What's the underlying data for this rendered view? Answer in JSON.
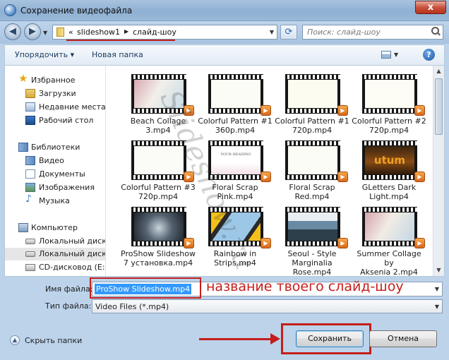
{
  "window": {
    "title": "Сохранение видеофайла",
    "close_glyph": "x"
  },
  "nav": {
    "back_icon": "back-arrow-icon",
    "forward_icon": "forward-arrow-icon",
    "breadcrumbs": [
      "slideshow1",
      "слайд-шоу"
    ],
    "breadcrumb_prefix": "«",
    "search_placeholder": "Поиск: слайд-шоу"
  },
  "toolbar": {
    "organize": "Упорядочить ▾",
    "new_folder": "Новая папка"
  },
  "sidebar": {
    "items": [
      {
        "label": "Избранное",
        "icon": "star-icon"
      },
      {
        "label": "Загрузки",
        "icon": "downloads-folder-icon"
      },
      {
        "label": "Недавние места",
        "icon": "recent-places-icon"
      },
      {
        "label": "Рабочий стол",
        "icon": "desktop-icon"
      },
      {
        "label": "Библиотеки",
        "icon": "libraries-icon"
      },
      {
        "label": "Видео",
        "icon": "video-library-icon"
      },
      {
        "label": "Документы",
        "icon": "documents-icon"
      },
      {
        "label": "Изображения",
        "icon": "pictures-icon"
      },
      {
        "label": "Музыка",
        "icon": "music-icon"
      },
      {
        "label": "Компьютер",
        "icon": "computer-icon"
      },
      {
        "label": "Локальный диск (",
        "icon": "drive-icon"
      },
      {
        "label": "Локальный диск (",
        "icon": "drive-icon"
      },
      {
        "label": "CD-дисковод (E:)",
        "icon": "cd-drive-icon"
      }
    ]
  },
  "files": [
    {
      "line1": "Beach Collage",
      "line2": "3.mp4",
      "line3": ""
    },
    {
      "line1": "Colorful Pattern #1",
      "line2": "360p.mp4",
      "line3": ""
    },
    {
      "line1": "Colorful Pattern #1",
      "line2": "720p.mp4",
      "line3": ""
    },
    {
      "line1": "Colorful Pattern #2",
      "line2": "720p.mp4",
      "line3": ""
    },
    {
      "line1": "Colorful Pattern #3",
      "line2": "720p.mp4",
      "line3": ""
    },
    {
      "line1": "Floral Scrap",
      "line2": "Pink.mp4",
      "line3": ""
    },
    {
      "line1": "Floral Scrap",
      "line2": "Red.mp4",
      "line3": ""
    },
    {
      "line1": "GLetters Dark",
      "line2": "Light.mp4",
      "line3": ""
    },
    {
      "line1": "ProShow Slideshow",
      "line2": "7 установка.mp4",
      "line3": ""
    },
    {
      "line1": "Rainbow in",
      "line2": "Strips.mp4",
      "line3": ""
    },
    {
      "line1": "Seoul - Style",
      "line2": "Marginalia",
      "line3": "Rose.mp4"
    },
    {
      "line1": "Summer Collage by",
      "line2": "Aksenia 2.mp4",
      "line3": ""
    }
  ],
  "thumb_text": {
    "floral_pink_heading": "YOUR HEADING",
    "gletters_word": "utum"
  },
  "form": {
    "filename_label": "Имя файла:",
    "filename_value": "ProShow Slideshow.mp4",
    "filetype_label": "Тип файла:",
    "filetype_value": "Video Files (*.mp4)"
  },
  "annotation": "название твоего слайд-шоу",
  "watermark": "Slideshow.ru",
  "footer": {
    "hide_folders": "Скрыть папки",
    "save": "Сохранить",
    "cancel": "Отмена"
  },
  "colors": {
    "accent_red": "#c41e1a",
    "selection_blue": "#3399ff"
  }
}
